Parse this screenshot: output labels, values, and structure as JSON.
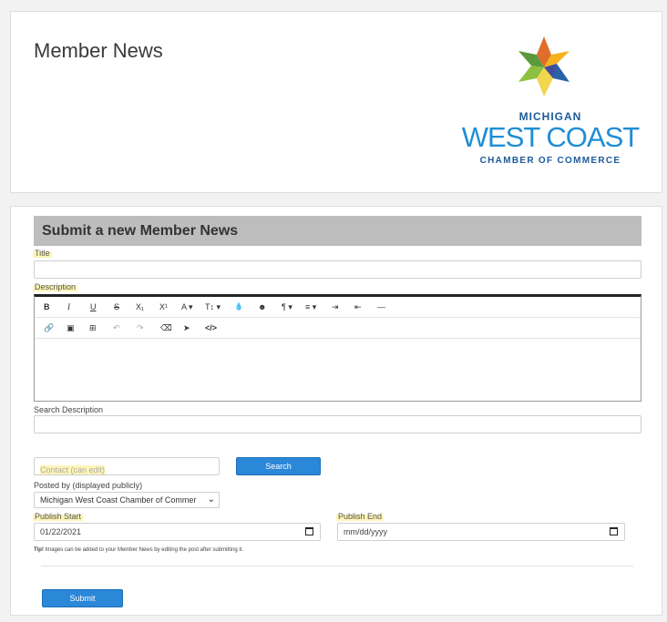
{
  "header": {
    "title": "Member News",
    "logo": {
      "line1": "MICHIGAN",
      "line2": "WEST COAST",
      "line3": "CHAMBER OF COMMERCE",
      "colors": [
        "#e06d2a",
        "#f5b21b",
        "#f3d64f",
        "#5a9a3c",
        "#8cc13f",
        "#2a62a8",
        "#4f3f94"
      ]
    }
  },
  "form": {
    "heading": "Submit a new Member News",
    "title_label": "Title",
    "title_value": "",
    "description_label": "Description",
    "toolbar_row1": [
      "B",
      "I",
      "U",
      "S",
      "X₁",
      "X¹",
      "A ▾",
      "T↕ ▾",
      "💧",
      "☻",
      "¶ ▾",
      "≡ ▾",
      "⇥",
      "⇤",
      "—"
    ],
    "toolbar_row2": [
      "🔗",
      "▣",
      "⊞",
      "↶",
      "↷",
      "⌫",
      "➤",
      "</>"
    ],
    "search_description_label": "Search Description",
    "search_description_value": "",
    "contact_placeholder": "Contact (can edit)",
    "search_button": "Search",
    "posted_by_label": "Posted by (displayed publicly)",
    "posted_by_value": "Michigan West Coast Chamber of Commer",
    "publish_start_label": "Publish Start",
    "publish_start_value": "01/22/2021",
    "publish_end_label": "Publish End",
    "publish_end_value": "mm/dd/yyyy",
    "tip_prefix": "Tip!",
    "tip_text": " Images can be added to your Member News by editing the post after submitting it.",
    "submit_button": "Submit"
  }
}
